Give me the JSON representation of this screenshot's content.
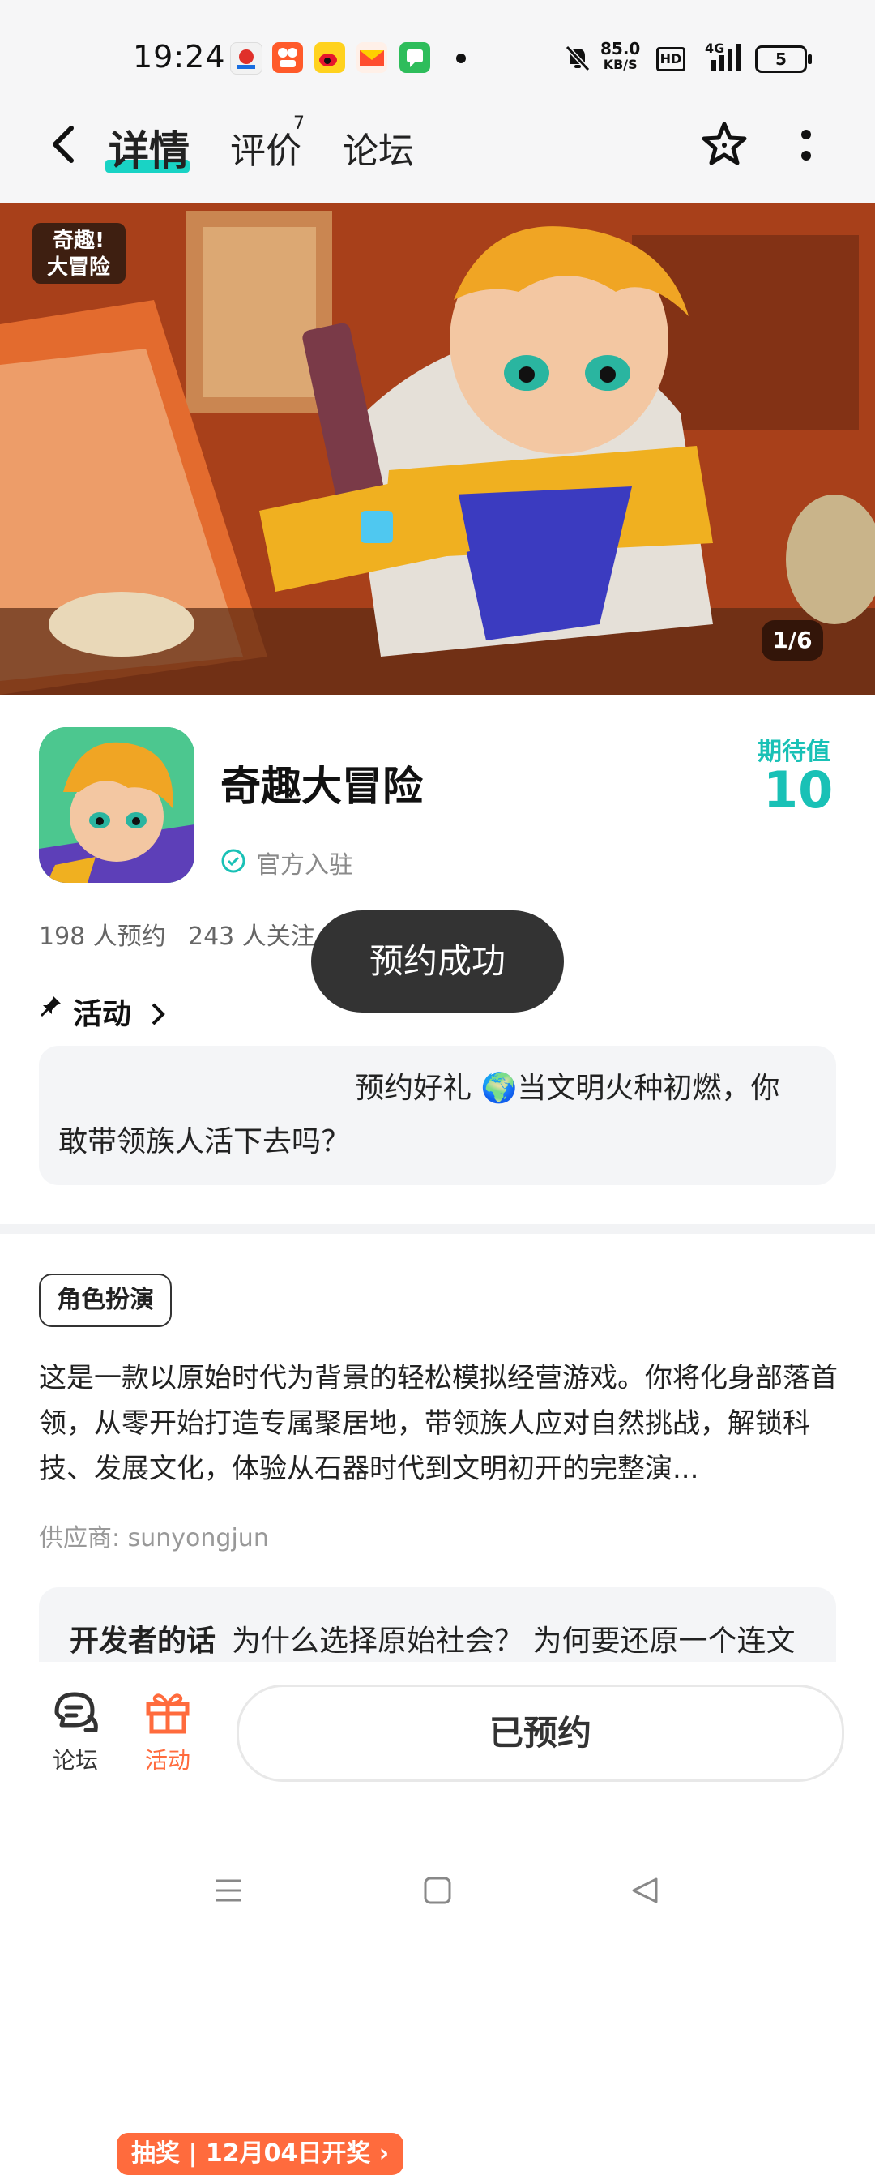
{
  "status_bar": {
    "time": "19:24",
    "net_speed_value": "85.0",
    "net_speed_unit": "KB/S",
    "hd": "HD",
    "network": "4G",
    "battery": "5",
    "icons": [
      "bell-muted-icon",
      "hd-icon",
      "signal-icon",
      "battery-icon"
    ]
  },
  "header": {
    "tabs": [
      {
        "label": "详情",
        "active": true
      },
      {
        "label": "评价",
        "badge": "7"
      },
      {
        "label": "论坛"
      }
    ]
  },
  "banner": {
    "page_indicator": "1/6",
    "logo_text": "奇趣!大冒险"
  },
  "app": {
    "name": "奇趣大冒险",
    "verified_label": "官方入驻",
    "expectation_label": "期待值",
    "expectation_value": "10",
    "reservations": "198 人预约",
    "followers": "243 人关注"
  },
  "toast": {
    "message": "预约成功"
  },
  "activity": {
    "title": "活动",
    "badge": "抽奖 | 12月04日开奖",
    "text": "预约好礼 🌍当文明火种初燃，你敢带领族人活下去吗？"
  },
  "details": {
    "tag": "角色扮演",
    "description": "这是一款以原始时代为背景的轻松模拟经营游戏。你将化身部落首领，从零开始打造专属聚居地，带领族人应对自然挑战，解锁科技、发展文化，体验从石器时代到文明初开的完整演...",
    "supplier": "供应商: sunyongjun"
  },
  "developer": {
    "title": "开发者的话",
    "text": "为什么选择原始社会？ 为何要还原一个连文"
  },
  "bottom_bar": {
    "forum_label": "论坛",
    "activity_label": "活动",
    "reserve_button": "已预约"
  },
  "colors": {
    "accent": "#19c1b6",
    "orange": "#ff6b3d",
    "toast_bg": "#333333"
  }
}
